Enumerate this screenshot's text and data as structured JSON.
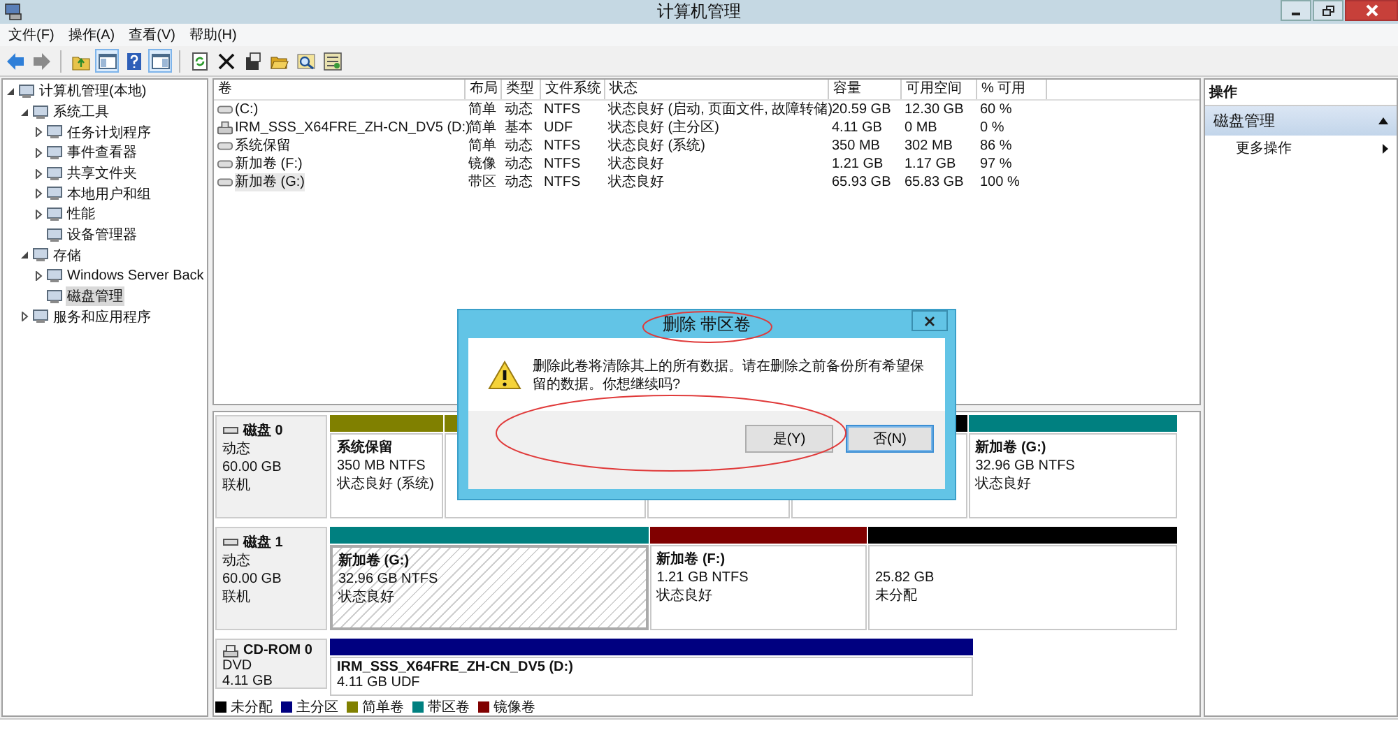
{
  "window": {
    "title": "计算机管理"
  },
  "menu": [
    "文件(F)",
    "操作(A)",
    "查看(V)",
    "帮助(H)"
  ],
  "toolbar": [
    {
      "kind": "back",
      "pressed": false
    },
    {
      "kind": "forward",
      "pressed": false
    },
    {
      "kind": "sep"
    },
    {
      "kind": "up",
      "pressed": false
    },
    {
      "kind": "tree",
      "pressed": true
    },
    {
      "kind": "help",
      "pressed": false
    },
    {
      "kind": "pane",
      "pressed": true
    },
    {
      "kind": "sep"
    },
    {
      "kind": "refresh",
      "pressed": false
    },
    {
      "kind": "delete",
      "pressed": false
    },
    {
      "kind": "properties",
      "pressed": false
    },
    {
      "kind": "open",
      "pressed": false
    },
    {
      "kind": "find",
      "pressed": false
    },
    {
      "kind": "settings",
      "pressed": false
    }
  ],
  "tree": [
    {
      "label": "计算机管理(本地)",
      "expanded": true,
      "selected": false,
      "children": [
        {
          "label": "系统工具",
          "expanded": true,
          "selected": false,
          "children": [
            {
              "label": "任务计划程序",
              "expanded": false,
              "selected": false
            },
            {
              "label": "事件查看器",
              "expanded": false,
              "selected": false
            },
            {
              "label": "共享文件夹",
              "expanded": false,
              "selected": false
            },
            {
              "label": "本地用户和组",
              "expanded": false,
              "selected": false
            },
            {
              "label": "性能",
              "expanded": false,
              "selected": false
            },
            {
              "label": "设备管理器",
              "selected": false
            }
          ]
        },
        {
          "label": "存储",
          "expanded": true,
          "selected": false,
          "children": [
            {
              "label": "Windows Server Back",
              "expanded": false,
              "selected": false
            },
            {
              "label": "磁盘管理",
              "selected": true
            }
          ]
        },
        {
          "label": "服务和应用程序",
          "expanded": false,
          "selected": false
        }
      ]
    }
  ],
  "table": {
    "columns": [
      "卷",
      "布局",
      "类型",
      "文件系统",
      "状态",
      "容量",
      "可用空间",
      "% 可用"
    ],
    "rows": [
      {
        "kind": "disk",
        "selected": false,
        "cells": [
          "(C:)",
          "简单",
          "动态",
          "NTFS",
          "状态良好 (启动, 页面文件, 故障转储)",
          "20.59 GB",
          "12.30 GB",
          "60 %"
        ]
      },
      {
        "kind": "cdrom",
        "selected": false,
        "cells": [
          "IRM_SSS_X64FRE_ZH-CN_DV5 (D:)",
          "简单",
          "基本",
          "UDF",
          "状态良好 (主分区)",
          "4.11 GB",
          "0 MB",
          "0 %"
        ]
      },
      {
        "kind": "disk",
        "selected": false,
        "cells": [
          "系统保留",
          "简单",
          "动态",
          "NTFS",
          "状态良好 (系统)",
          "350 MB",
          "302 MB",
          "86 %"
        ]
      },
      {
        "kind": "disk",
        "selected": false,
        "cells": [
          "新加卷 (F:)",
          "镜像",
          "动态",
          "NTFS",
          "状态良好",
          "1.21 GB",
          "1.17 GB",
          "97 %"
        ]
      },
      {
        "kind": "disk",
        "selected": true,
        "cells": [
          "新加卷 (G:)",
          "带区",
          "动态",
          "NTFS",
          "状态良好",
          "65.93 GB",
          "65.83 GB",
          "100 %"
        ]
      }
    ]
  },
  "disks": [
    {
      "kind": "disk",
      "name": "磁盘 0",
      "lines": [
        "动态",
        "60.00 GB",
        "联机"
      ],
      "partitions": [
        {
          "kind": "simple",
          "selected": false,
          "title": "系统保留",
          "lines": [
            "350 MB NTFS",
            "状态良好 (系统)"
          ]
        },
        {
          "kind": "simple",
          "selected": false
        },
        {
          "selected": false
        },
        {
          "kind": "unallocated",
          "selected": false
        },
        {
          "kind": "striped",
          "selected": false,
          "title": "新加卷  (G:)",
          "lines": [
            "32.96 GB NTFS",
            "状态良好"
          ]
        }
      ]
    },
    {
      "kind": "disk",
      "name": "磁盘 1",
      "lines": [
        "动态",
        "60.00 GB",
        "联机"
      ],
      "partitions": [
        {
          "kind": "striped",
          "selected": true,
          "title": "新加卷  (G:)",
          "lines": [
            "32.96 GB NTFS",
            "状态良好"
          ]
        },
        {
          "kind": "mirror",
          "selected": false,
          "title": "新加卷  (F:)",
          "lines": [
            "1.21 GB NTFS",
            "状态良好"
          ]
        },
        {
          "kind": "unallocated",
          "selected": false,
          "lines": [
            "25.82 GB",
            "未分配"
          ]
        }
      ]
    },
    {
      "kind": "cdrom",
      "name": "CD-ROM 0",
      "lines": [
        "DVD",
        "4.11 GB"
      ],
      "partitions": [
        {
          "kind": "primary",
          "selected": false,
          "title": "IRM_SSS_X64FRE_ZH-CN_DV5  (D:)",
          "lines": [
            "4.11 GB UDF"
          ]
        }
      ]
    }
  ],
  "legend": [
    {
      "kind": "unallocated",
      "label": "未分配"
    },
    {
      "kind": "primary",
      "label": "主分区"
    },
    {
      "kind": "simple",
      "label": "简单卷"
    },
    {
      "kind": "striped",
      "label": "带区卷"
    },
    {
      "kind": "mirror",
      "label": "镜像卷"
    }
  ],
  "actions": {
    "header": "操作",
    "section": "磁盘管理",
    "items": [
      "更多操作"
    ]
  },
  "dialog": {
    "title": "删除 带区卷",
    "message": "删除此卷将清除其上的所有数据。请在删除之前备份所有希望保留的数据。你想继续吗?",
    "buttons": [
      {
        "label": "是(Y)",
        "default": false
      },
      {
        "label": "否(N)",
        "default": true
      }
    ]
  }
}
